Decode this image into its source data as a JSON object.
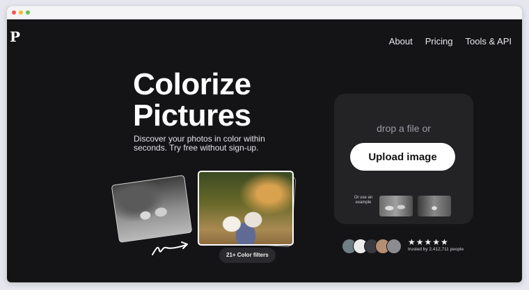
{
  "brand": {
    "logo_letter": "P"
  },
  "nav": {
    "items": [
      {
        "label": "About"
      },
      {
        "label": "Pricing"
      },
      {
        "label": "Tools & API"
      }
    ]
  },
  "hero": {
    "title_line1": "Colorize",
    "title_line2": "Pictures",
    "subtitle": "Discover your photos in color within seconds. Try free without sign-up.",
    "filters_pill": "21+ Color filters"
  },
  "upload": {
    "drop_text": "drop a file or",
    "button_label": "Upload image",
    "example_label": "Or use an example"
  },
  "social_proof": {
    "stars": "★★★★★",
    "rating": 5,
    "trusted_text": "trusted by 2,412,711 people"
  },
  "colors": {
    "background": "#141416",
    "button": "#ffffff",
    "panel": "#232326"
  }
}
